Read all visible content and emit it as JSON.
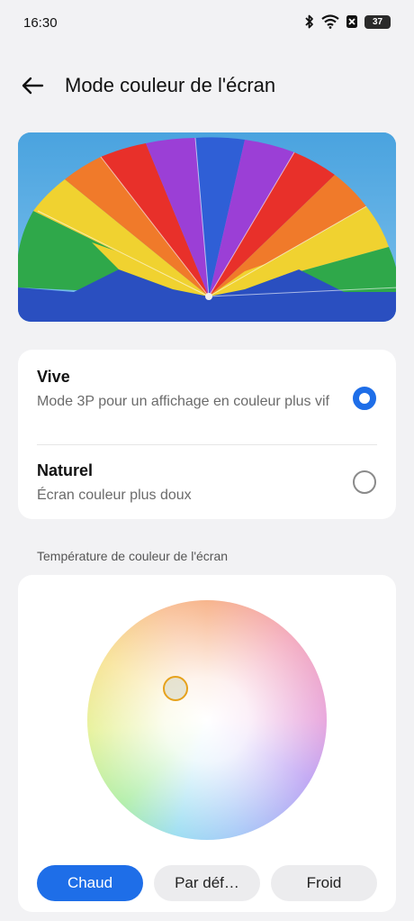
{
  "status": {
    "time": "16:30",
    "battery": "37"
  },
  "header": {
    "title": "Mode couleur de l'écran"
  },
  "modes": [
    {
      "title": "Vive",
      "description": "Mode 3P pour un affichage en couleur plus vif",
      "selected": true
    },
    {
      "title": "Naturel",
      "description": "Écran couleur plus doux",
      "selected": false
    }
  ],
  "temperature": {
    "section_label": "Température de couleur de l'écran",
    "buttons": [
      {
        "label": "Chaud",
        "active": true
      },
      {
        "label": "Par déf…",
        "active": false
      },
      {
        "label": "Froid",
        "active": false
      }
    ]
  },
  "colors": {
    "accent": "#1e6ee8",
    "background": "#f2f2f4"
  }
}
